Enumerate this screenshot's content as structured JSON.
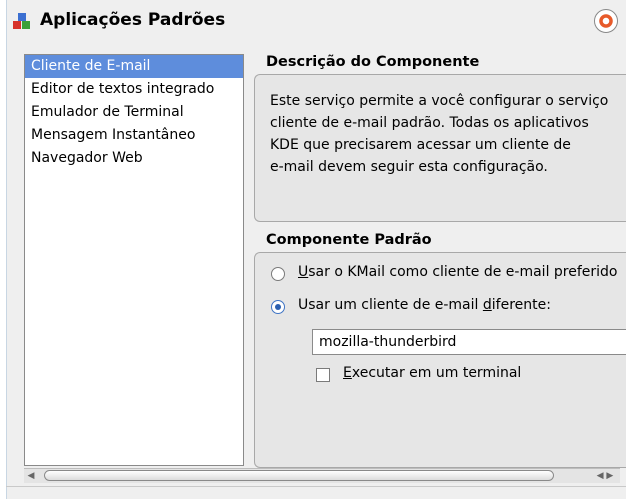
{
  "header": {
    "title": "Aplicações Padrões",
    "icon": "blocks-icon",
    "help_icon": "lifebuoy-icon"
  },
  "sidebar": {
    "items": [
      {
        "label": "Cliente de E-mail",
        "selected": true
      },
      {
        "label": "Editor de textos integrado",
        "selected": false
      },
      {
        "label": "Emulador de Terminal",
        "selected": false
      },
      {
        "label": "Mensagem Instantâneo",
        "selected": false
      },
      {
        "label": "Navegador Web",
        "selected": false
      }
    ]
  },
  "description": {
    "title": "Descrição do Componente",
    "lines": [
      "Este serviço permite a você configurar o serviço",
      "cliente de e-mail padrão. Todas os aplicativos",
      "KDE que precisarem acessar um cliente de",
      "e-mail devem seguir esta configuração."
    ]
  },
  "component": {
    "title": "Componente Padrão",
    "option_kmail": {
      "prefix": "",
      "accel": "U",
      "rest": "sar o KMail como cliente de e-mail preferido",
      "checked": false
    },
    "option_other": {
      "prefix": "Usar um cliente de e-mail ",
      "accel": "d",
      "rest": "iferente:",
      "checked": true
    },
    "client_value": "mozilla-thunderbird",
    "terminal_option": {
      "accel": "E",
      "rest": "xecutar em um terminal",
      "checked": false
    }
  },
  "colors": {
    "selection": "#5e8ddc",
    "radio_accent": "#2b5fb0",
    "help_icon": "#e75a2a"
  }
}
